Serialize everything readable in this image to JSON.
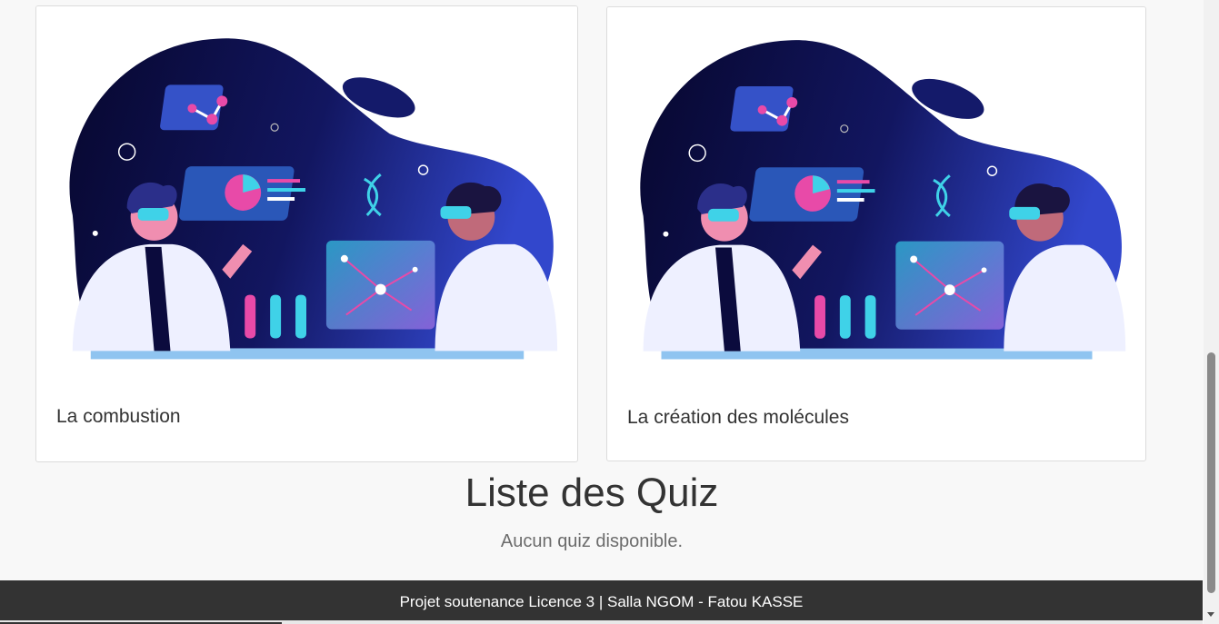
{
  "cards": [
    {
      "title": "La combustion",
      "image": "scientists-illustration"
    },
    {
      "title": "La création des molécules",
      "image": "scientists-illustration"
    }
  ],
  "quiz_section": {
    "title": "Liste des Quiz",
    "empty_message": "Aucun quiz disponible."
  },
  "footer": {
    "text": "Projet soutenance Licence 3 | Salla NGOM - Fatou KASSE"
  },
  "colors": {
    "footer_bg": "#333333",
    "page_bg": "#f8f8f8",
    "blob_dark": "#0b0b3d",
    "blob_blue": "#2a3cc0",
    "accent_pink": "#e84aa8",
    "accent_cyan": "#3fd2e8"
  }
}
